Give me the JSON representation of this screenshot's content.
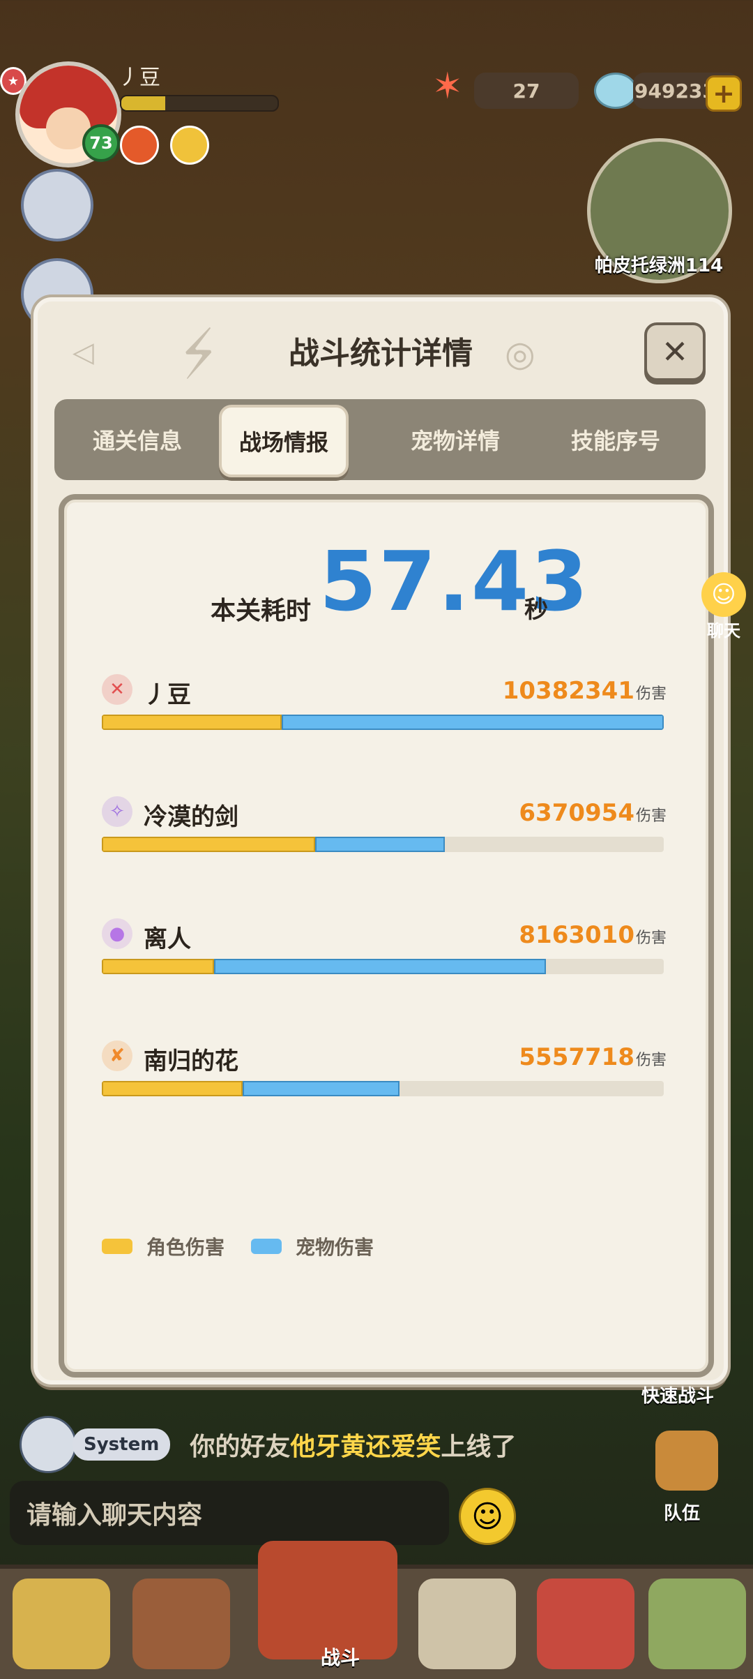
{
  "hud": {
    "player_name": "丿豆",
    "level": "73",
    "xp_fraction": 0.28,
    "starfish_count": "27",
    "gem_count": "949233",
    "plus_label": "+",
    "map_name": "帕皮托绿洲114"
  },
  "modal": {
    "title": "战斗统计详情",
    "close_label": "✕",
    "tabs": [
      {
        "label": "通关信息",
        "active": false
      },
      {
        "label": "战场情报",
        "active": true
      },
      {
        "label": "宠物详情",
        "active": false
      },
      {
        "label": "技能序号",
        "active": false
      }
    ],
    "time_label": "本关耗时",
    "time_value": "57.43",
    "time_unit": "秒",
    "damage_unit": "伤害",
    "rows": [
      {
        "name": "丿豆",
        "damage": "10382341",
        "char_fraction": 0.32,
        "pet_fraction": 0.68,
        "total_fraction": 1.0,
        "icon_color": "#e25050"
      },
      {
        "name": "冷漠的剑",
        "damage": "6370954",
        "char_fraction": 0.38,
        "pet_fraction": 0.23,
        "total_fraction": 0.61,
        "icon_color": "#9b6be0"
      },
      {
        "name": "离人",
        "damage": "8163010",
        "char_fraction": 0.2,
        "pet_fraction": 0.59,
        "total_fraction": 0.79,
        "icon_color": "#b676e6"
      },
      {
        "name": "南归的花",
        "damage": "5557718",
        "char_fraction": 0.25,
        "pet_fraction": 0.28,
        "total_fraction": 0.53,
        "icon_color": "#f08a2c"
      }
    ],
    "legend": {
      "character": "角色伤害",
      "pet": "宠物伤害",
      "character_color": "#f5c33a",
      "pet_color": "#66baf0"
    }
  },
  "chat": {
    "side_label": "聊天",
    "system_tag": "System",
    "message_prefix": "你的好友",
    "message_friend": "他牙黄还爱笑",
    "message_suffix": "上线了",
    "input_placeholder": "请输入聊天内容",
    "quick_battle": "快速战斗",
    "team": "队伍"
  },
  "nav": {
    "battle_label": "战斗"
  }
}
